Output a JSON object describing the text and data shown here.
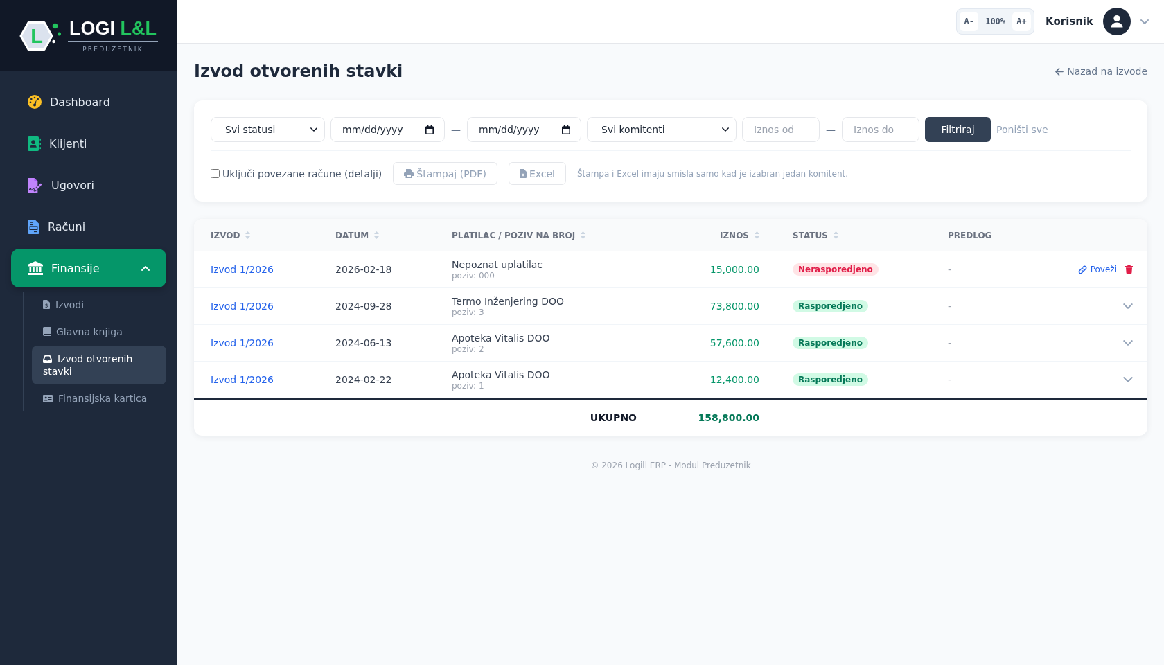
{
  "sidebar": {
    "logo": {
      "letter": "L",
      "name": "LOGI",
      "accent": "L&L",
      "tagline": "PREDUZETNIK"
    },
    "items": [
      {
        "label": "Dashboard",
        "selected": false
      },
      {
        "label": "Klijenti",
        "selected": false
      },
      {
        "label": "Ugovori",
        "selected": false
      },
      {
        "label": "Računi",
        "selected": false
      },
      {
        "label": "Finansije",
        "selected": true,
        "expanded": true,
        "children": [
          {
            "label": "Izvodi",
            "selected": false
          },
          {
            "label": "Glavna knjiga",
            "selected": false
          },
          {
            "label": "Izvod otvorenih stavki",
            "selected": true
          },
          {
            "label": "Finansijska kartica",
            "selected": false
          }
        ]
      }
    ]
  },
  "top_bar": {
    "font_decrease": "A-",
    "zoom_level": "100%",
    "font_increase": "A+",
    "user_name": "Korisnik"
  },
  "page": {
    "title": "Izvod otvorenih stavki",
    "back_link": "Nazad na izvode"
  },
  "filters": {
    "status_select": "Svi statusi",
    "date_from": {
      "placeholder": "mm/dd/yyyy"
    },
    "date_separator": "—",
    "date_to": {
      "placeholder": "mm/dd/yyyy"
    },
    "client_select": "Svi komitenti",
    "amount_from": {
      "placeholder": "Iznos od"
    },
    "amount_separator": "—",
    "amount_to": {
      "placeholder": "Iznos do"
    },
    "filter_button": "Filtriraj",
    "reset_link": "Poništi sve",
    "include_linked": {
      "label": "Uključi povezane račune (detalji)",
      "checked": false
    },
    "print_button": {
      "label": "Štampaj (PDF)",
      "disabled": true
    },
    "excel_button": {
      "label": "Excel",
      "disabled": true
    },
    "note": "Štampa i Excel imaju smisla samo kad je izabran jedan komitent."
  },
  "table": {
    "columns": [
      {
        "label": "IZVOD",
        "sortable": true
      },
      {
        "label": "DATUM",
        "sortable": true
      },
      {
        "label": "PLATILAC / POZIV NA BROJ",
        "sortable": true
      },
      {
        "label": "IZNOS",
        "sortable": true
      },
      {
        "label": "STATUS",
        "sortable": true
      },
      {
        "label": "PREDLOG",
        "sortable": false
      }
    ],
    "rows": [
      {
        "statement": "Izvod 1/2026",
        "date": "2026-02-18",
        "payer": "Nepoznat uplatilac",
        "reference": "poziv: 000",
        "amount": "15,000.00",
        "status": {
          "kind": "unassigned",
          "label": "Nerasporedjeno"
        },
        "suggestion": "-",
        "action": {
          "kind": "link",
          "label": "Poveži"
        }
      },
      {
        "statement": "Izvod 1/2026",
        "date": "2024-09-28",
        "payer": "Termo Inženjering DOO",
        "reference": "poziv: 3",
        "amount": "73,800.00",
        "status": {
          "kind": "assigned",
          "label": "Rasporedjeno"
        },
        "suggestion": "-",
        "action": {
          "kind": "expand",
          "expanded": false
        }
      },
      {
        "statement": "Izvod 1/2026",
        "date": "2024-06-13",
        "payer": "Apoteka Vitalis DOO",
        "reference": "poziv: 2",
        "amount": "57,600.00",
        "status": {
          "kind": "assigned",
          "label": "Rasporedjeno"
        },
        "suggestion": "-",
        "action": {
          "kind": "expand",
          "expanded": false
        }
      },
      {
        "statement": "Izvod 1/2026",
        "date": "2024-02-22",
        "payer": "Apoteka Vitalis DOO",
        "reference": "poziv: 1",
        "amount": "12,400.00",
        "status": {
          "kind": "assigned",
          "label": "Rasporedjeno"
        },
        "suggestion": "-",
        "action": {
          "kind": "expand",
          "expanded": false
        }
      }
    ],
    "total": {
      "label": "UKUPNO",
      "amount": "158,800.00"
    }
  },
  "footer": "© 2026 Logill ERP - Modul Preduzetnik"
}
